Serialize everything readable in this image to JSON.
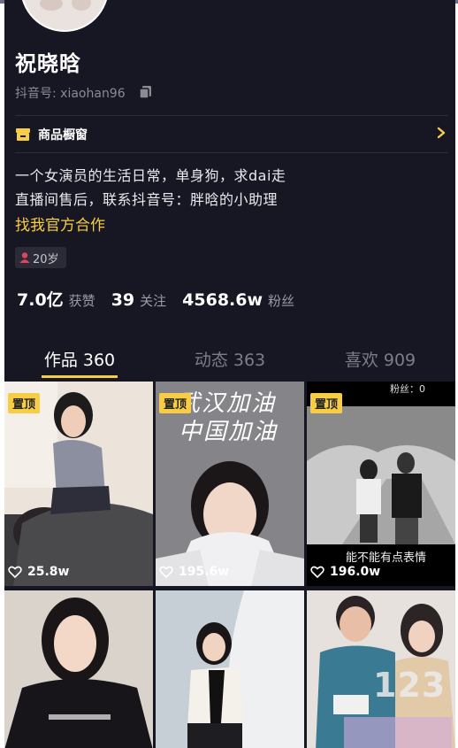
{
  "profile": {
    "name": "祝晓晗",
    "douyin_id": "抖音号: xiaohan96"
  },
  "shop": {
    "label": "商品橱窗"
  },
  "bio": {
    "line1": "一个女演员的生活日常，单身狗，求dai走",
    "line2": "直播间售后，联系抖音号：胖晗的小助理",
    "cooperation": "找我官方合作"
  },
  "tag": {
    "age": "20岁"
  },
  "stats": {
    "likes_value": "7.0亿",
    "likes_label": "获赞",
    "following_value": "39",
    "following_label": "关注",
    "followers_value": "4568.6w",
    "followers_label": "粉丝"
  },
  "tabs": [
    {
      "label": "作品 360",
      "active": true
    },
    {
      "label": "动态 363",
      "active": false
    },
    {
      "label": "喜欢 909",
      "active": false
    }
  ],
  "videos": [
    {
      "pinned": "置顶",
      "likes": "25.8w"
    },
    {
      "pinned": "置顶",
      "likes": "195.6w",
      "overlay_text_1": "武汉加油",
      "overlay_text_2": "中国加油"
    },
    {
      "pinned": "置顶",
      "likes": "196.0w",
      "overlay_top": "粉丝：0",
      "caption": "能不能有点表情"
    },
    {},
    {},
    {}
  ],
  "watermark": "123",
  "colors": {
    "background": "#161722",
    "accent": "#f7cd46",
    "secondary_text": "#8a8b95"
  }
}
